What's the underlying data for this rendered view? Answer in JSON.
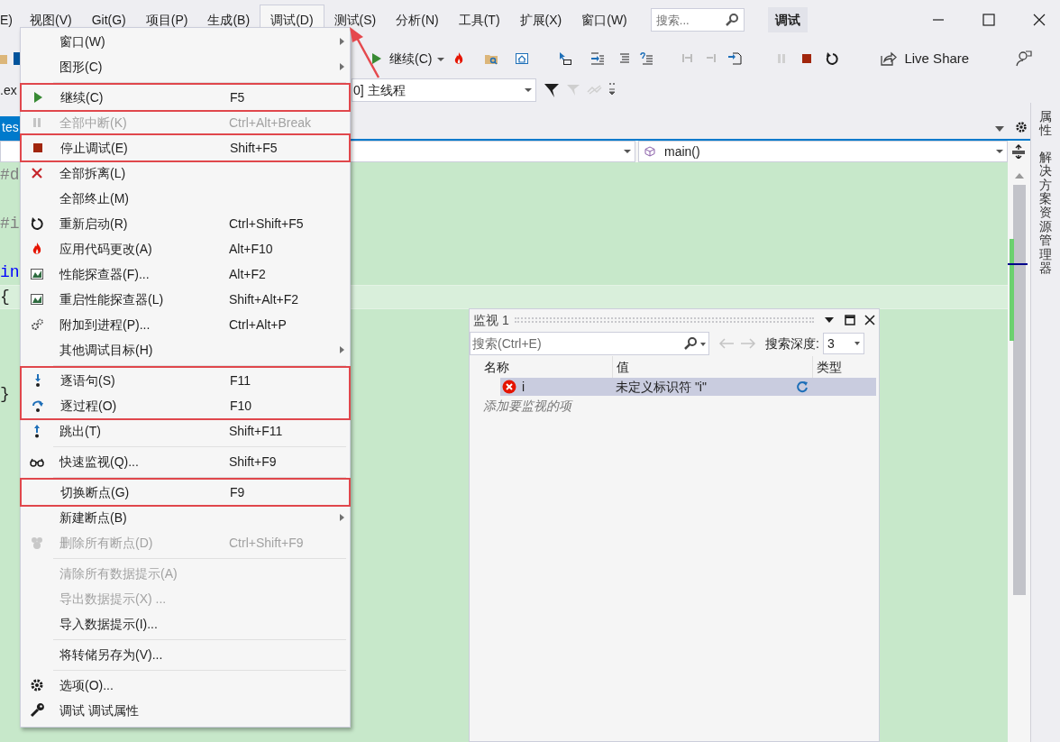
{
  "menu_bar": {
    "items": [
      {
        "label": "E)",
        "selected": false
      },
      {
        "label": "视图(V)",
        "selected": false
      },
      {
        "label": "Git(G)",
        "selected": false
      },
      {
        "label": "项目(P)",
        "selected": false
      },
      {
        "label": "生成(B)",
        "selected": false
      },
      {
        "label": "调试(D)",
        "selected": true
      },
      {
        "label": "测试(S)",
        "selected": false
      },
      {
        "label": "分析(N)",
        "selected": false
      },
      {
        "label": "工具(T)",
        "selected": false
      },
      {
        "label": "扩展(X)",
        "selected": false
      },
      {
        "label": "窗口(W)",
        "selected": false
      }
    ]
  },
  "search": {
    "placeholder": "搜索..."
  },
  "mode_badge": "调试",
  "toolbar": {
    "continue_label": "继续(C)",
    "live_share": "Live Share"
  },
  "debug_bar": {
    "process_fragment": ".ex",
    "thread": "0] 主线程"
  },
  "document_tab": {
    "label": "tes",
    "selected": true
  },
  "nav_bar": {
    "member": "main()"
  },
  "code_lines": [
    {
      "kind": "preprocessor",
      "text": "#d",
      "current": false
    },
    {
      "kind": "blank",
      "current": false
    },
    {
      "kind": "preprocessor",
      "text": "#i",
      "current": false
    },
    {
      "kind": "blank",
      "current": false
    },
    {
      "kind": "keyword",
      "text": "in",
      "current": false
    },
    {
      "kind": "plain",
      "text": "{",
      "current": true
    },
    {
      "kind": "blank",
      "current": false
    },
    {
      "kind": "blank",
      "current": false
    },
    {
      "kind": "blank",
      "current": false
    },
    {
      "kind": "plain",
      "text": "}",
      "current": false
    }
  ],
  "side_tabs": [
    "属性",
    "解决方案资源管理器"
  ],
  "debug_menu": {
    "items": [
      {
        "kind": "item",
        "label": "窗口(W)",
        "submenu": true,
        "disabled": false,
        "highlighted": false
      },
      {
        "kind": "item",
        "label": "图形(C)",
        "submenu": true,
        "disabled": false,
        "highlighted": false
      },
      {
        "kind": "separator"
      },
      {
        "kind": "item",
        "label": "继续(C)",
        "shortcut": "F5",
        "submenu": false,
        "disabled": false,
        "highlighted": true
      },
      {
        "kind": "item",
        "label": "全部中断(K)",
        "shortcut": "Ctrl+Alt+Break",
        "submenu": false,
        "disabled": true,
        "highlighted": false
      },
      {
        "kind": "item",
        "label": "停止调试(E)",
        "shortcut": "Shift+F5",
        "submenu": false,
        "disabled": false,
        "highlighted": true
      },
      {
        "kind": "item",
        "label": "全部拆离(L)",
        "submenu": false,
        "disabled": false,
        "highlighted": false
      },
      {
        "kind": "item",
        "label": "全部终止(M)",
        "submenu": false,
        "disabled": false,
        "highlighted": false
      },
      {
        "kind": "item",
        "label": "重新启动(R)",
        "shortcut": "Ctrl+Shift+F5",
        "submenu": false,
        "disabled": false,
        "highlighted": false
      },
      {
        "kind": "item",
        "label": "应用代码更改(A)",
        "shortcut": "Alt+F10",
        "submenu": false,
        "disabled": false,
        "highlighted": false
      },
      {
        "kind": "item",
        "label": "性能探查器(F)...",
        "shortcut": "Alt+F2",
        "submenu": false,
        "disabled": false,
        "highlighted": false
      },
      {
        "kind": "item",
        "label": "重启性能探查器(L)",
        "shortcut": "Shift+Alt+F2",
        "submenu": false,
        "disabled": false,
        "highlighted": false
      },
      {
        "kind": "item",
        "label": "附加到进程(P)...",
        "shortcut": "Ctrl+Alt+P",
        "submenu": false,
        "disabled": false,
        "highlighted": false
      },
      {
        "kind": "item",
        "label": "其他调试目标(H)",
        "submenu": true,
        "disabled": false,
        "highlighted": false
      },
      {
        "kind": "separator"
      },
      {
        "kind": "item",
        "label": "逐语句(S)",
        "shortcut": "F11",
        "submenu": false,
        "disabled": false,
        "highlighted": true
      },
      {
        "kind": "item",
        "label": "逐过程(O)",
        "shortcut": "F10",
        "submenu": false,
        "disabled": false,
        "highlighted": true
      },
      {
        "kind": "item",
        "label": "跳出(T)",
        "shortcut": "Shift+F11",
        "submenu": false,
        "disabled": false,
        "highlighted": false
      },
      {
        "kind": "separator"
      },
      {
        "kind": "item",
        "label": "快速监视(Q)...",
        "shortcut": "Shift+F9",
        "submenu": false,
        "disabled": false,
        "highlighted": false
      },
      {
        "kind": "separator"
      },
      {
        "kind": "item",
        "label": "切换断点(G)",
        "shortcut": "F9",
        "submenu": false,
        "disabled": false,
        "highlighted": true
      },
      {
        "kind": "item",
        "label": "新建断点(B)",
        "submenu": true,
        "disabled": false,
        "highlighted": false
      },
      {
        "kind": "item",
        "label": "删除所有断点(D)",
        "shortcut": "Ctrl+Shift+F9",
        "submenu": false,
        "disabled": true,
        "highlighted": false
      },
      {
        "kind": "separator"
      },
      {
        "kind": "item",
        "label": "清除所有数据提示(A)",
        "submenu": false,
        "disabled": true,
        "highlighted": false
      },
      {
        "kind": "item",
        "label": "导出数据提示(X) ...",
        "submenu": false,
        "disabled": true,
        "highlighted": false
      },
      {
        "kind": "item",
        "label": "导入数据提示(I)...",
        "submenu": false,
        "disabled": false,
        "highlighted": false
      },
      {
        "kind": "separator"
      },
      {
        "kind": "item",
        "label": "将转储另存为(V)...",
        "submenu": false,
        "disabled": false,
        "highlighted": false
      },
      {
        "kind": "separator"
      },
      {
        "kind": "item",
        "label": "选项(O)...",
        "submenu": false,
        "disabled": false,
        "highlighted": false
      },
      {
        "kind": "item",
        "label": "调试 调试属性",
        "submenu": false,
        "disabled": false,
        "highlighted": false
      }
    ]
  },
  "watch": {
    "title": "监视 1",
    "search_placeholder": "搜索(Ctrl+E)",
    "depth_label": "搜索深度:",
    "depth": "3",
    "columns": [
      "名称",
      "值",
      "类型"
    ],
    "rows": [
      {
        "name": "i",
        "value": "未定义标识符 \"i\"",
        "selected": true
      }
    ],
    "add_hint": "添加要监视的项"
  }
}
